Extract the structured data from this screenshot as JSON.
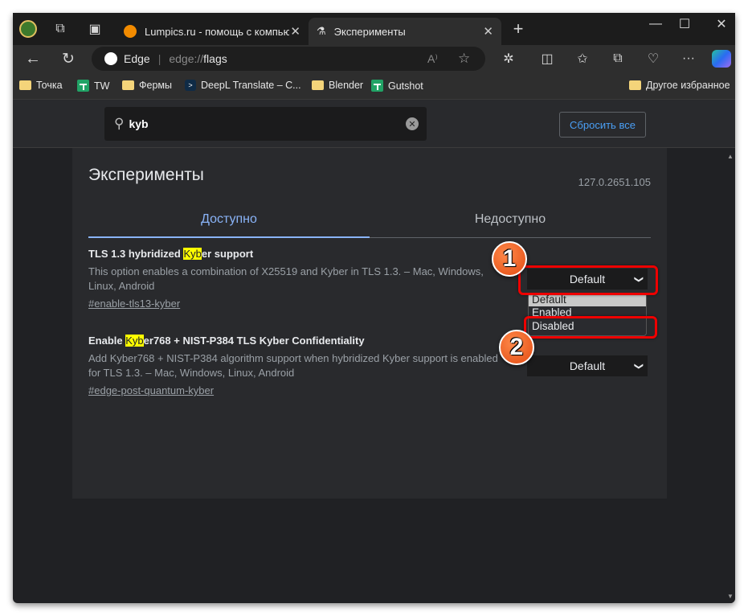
{
  "browser": {
    "tabs": [
      {
        "label": "Lumpics.ru - помощь с компьют",
        "icon": "orange-icon"
      },
      {
        "label": "Эксперименты",
        "icon": "flask-icon",
        "active": true
      }
    ],
    "window_controls": [
      "minimize",
      "maximize",
      "close"
    ],
    "address": {
      "brand": "Edge",
      "url_prefix": "edge://",
      "url_path": "flags"
    },
    "bookmarks": [
      {
        "label": "Точка",
        "icon": "folder-icon"
      },
      {
        "label": "TW",
        "icon": "sheets-icon"
      },
      {
        "label": "Фермы",
        "icon": "folder-icon"
      },
      {
        "label": "DeepL Translate – C...",
        "icon": "deepl-icon"
      },
      {
        "label": "Blender",
        "icon": "folder-icon"
      },
      {
        "label": "Gutshot",
        "icon": "sheets-icon"
      }
    ],
    "other_bookmarks": "Другое избранное"
  },
  "page": {
    "search_value": "kyb",
    "reset_label": "Сбросить все",
    "title": "Эксперименты",
    "version": "127.0.2651.105",
    "tabs": [
      "Доступно",
      "Недоступно"
    ],
    "accent": "#8ab4f8",
    "flags": [
      {
        "title_pre": "TLS 1.3 hybridized ",
        "title_hl": "Kyb",
        "title_post": "er support",
        "description": "This option enables a combination of X25519 and Kyber in TLS 1.3. – Mac, Windows, Linux, Android",
        "link": "#enable-tls13-kyber",
        "value": "Default"
      },
      {
        "title_pre": "Enable ",
        "title_hl": "Kyb",
        "title_post": "er768 + NIST-P384 TLS Kyber Confidentiality",
        "description": "Add Kyber768 + NIST-P384 algorithm support when hybridized Kyber support is enabled for TLS 1.3. – Mac, Windows, Linux, Android",
        "link": "#edge-post-quantum-kyber",
        "value": "Default"
      }
    ],
    "dropdown_options": [
      "Default",
      "Enabled",
      "Disabled"
    ]
  },
  "annotations": [
    "1",
    "2"
  ]
}
